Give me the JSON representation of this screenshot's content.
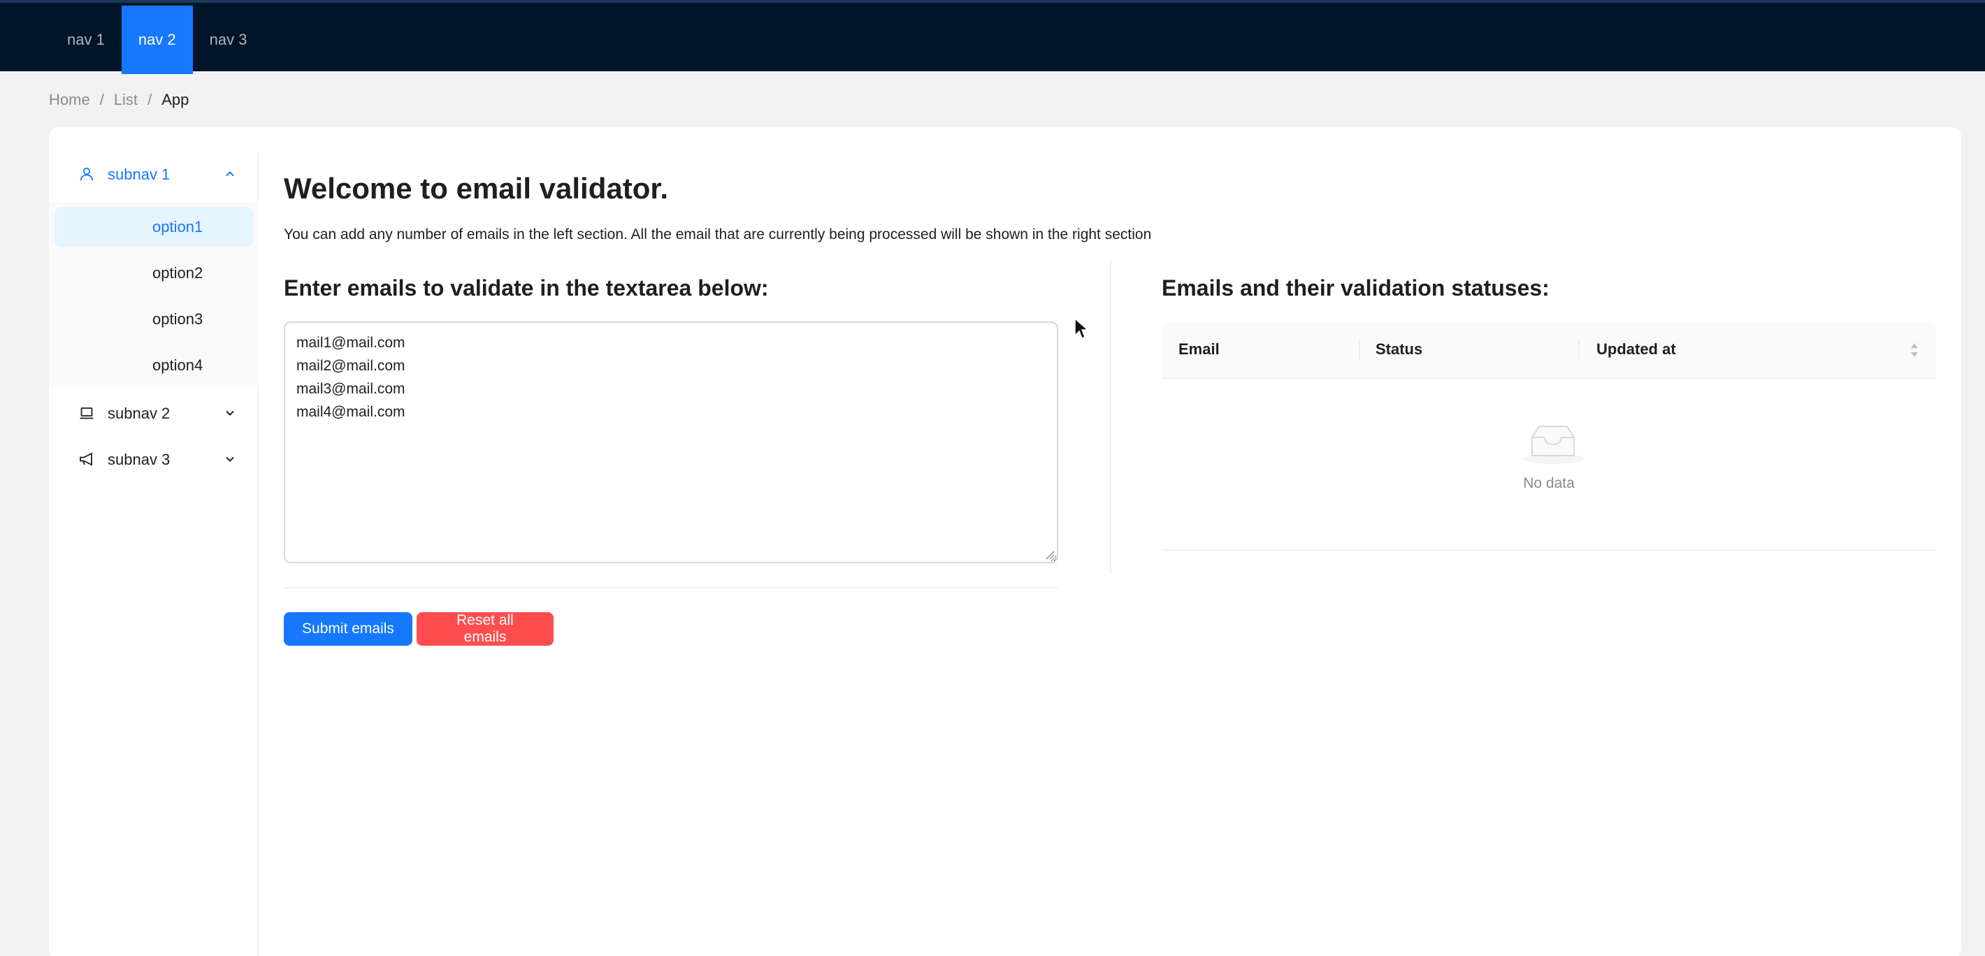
{
  "header": {
    "nav": [
      {
        "label": "nav 1"
      },
      {
        "label": "nav 2",
        "active": true
      },
      {
        "label": "nav 3"
      }
    ],
    "background": "#001529",
    "accent": "#1677ff"
  },
  "breadcrumb": {
    "items": [
      "Home",
      "List",
      "App"
    ],
    "separator": "/"
  },
  "sidebar": {
    "submenus": [
      {
        "label": "subnav 1",
        "icon": "user-icon",
        "expanded": true,
        "items": [
          "option1",
          "option2",
          "option3",
          "option4"
        ],
        "selected": "option1"
      },
      {
        "label": "subnav 2",
        "icon": "laptop-icon",
        "expanded": false
      },
      {
        "label": "subnav 3",
        "icon": "notification-icon",
        "expanded": false
      }
    ]
  },
  "main": {
    "title": "Welcome to email validator.",
    "description": "You can add any number of emails in the left section. All the email that are currently being processed will be shown in the right section",
    "left": {
      "heading": "Enter emails to validate in the textarea below:",
      "textarea_value": "mail1@mail.com\nmail2@mail.com\nmail3@mail.com\nmail4@mail.com",
      "submit_label": "Submit emails",
      "reset_label": "Reset all emails"
    },
    "right": {
      "heading": "Emails and their validation statuses:",
      "columns": [
        "Email",
        "Status",
        "Updated at"
      ],
      "sortable_column": "Updated at",
      "rows": [],
      "empty_text": "No data"
    }
  },
  "colors": {
    "primary": "#1677ff",
    "danger": "#ff4d4f",
    "selected_bg": "#e6f4ff"
  }
}
